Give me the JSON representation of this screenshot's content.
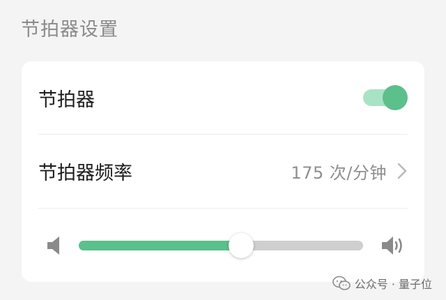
{
  "section": {
    "title": "节拍器设置"
  },
  "metronome_toggle": {
    "label": "节拍器",
    "on": true
  },
  "frequency": {
    "label": "节拍器频率",
    "value": "175 次/分钟"
  },
  "volume": {
    "level": 0.57
  },
  "watermark": {
    "text": "公众号 · 量子位"
  },
  "colors": {
    "accent": "#5bc08b",
    "accent_light": "#a9e3c5",
    "track": "#cfcfcf",
    "card": "#ffffff",
    "background": "#f4f4f4",
    "muted_text": "#8a8a8a"
  },
  "icons": {
    "frequency_chevron": "chevron-right-icon",
    "volume_min": "volume-low-icon",
    "volume_max": "volume-high-icon",
    "watermark": "wechat-icon"
  }
}
